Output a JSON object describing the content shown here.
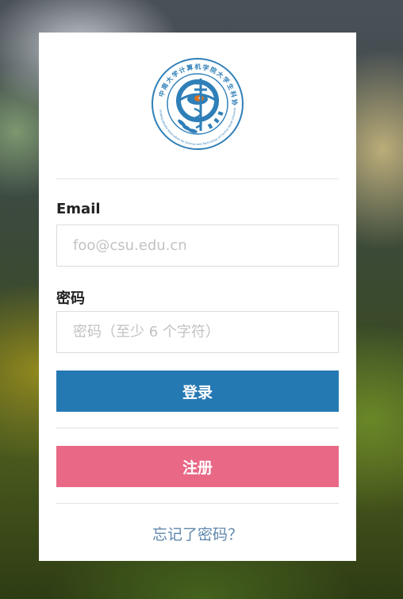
{
  "logo": {
    "emblem": "caduceus-emblem",
    "ring_text_top": "中南大学计算机学院大学生科协",
    "ring_text_bottom": "Undergraduate Association for Science and Technology of Central South University"
  },
  "form": {
    "email_label": "Email",
    "email_placeholder": "foo@csu.edu.cn",
    "email_value": "",
    "password_label": "密码",
    "password_placeholder": "密码（至少 6 个字符）",
    "password_value": ""
  },
  "buttons": {
    "login_label": "登录",
    "register_label": "注册"
  },
  "links": {
    "forgot_password": "忘记了密码？"
  },
  "colors": {
    "login_button": "#2579b3",
    "register_button": "#e86886",
    "link": "#5f86ad"
  }
}
